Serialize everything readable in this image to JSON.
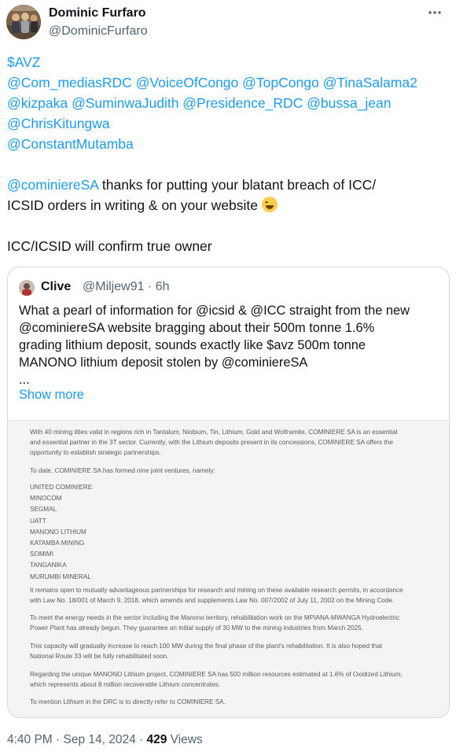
{
  "author": {
    "name": "Dominic Furfaro",
    "handle": "@DominicFurfaro"
  },
  "more_icon": "ellipsis-icon",
  "tweet": {
    "line1": "$AVZ",
    "line2": [
      "@Com_mediasRDC",
      "@VoiceOfCongo",
      "@TopCongo",
      "@TinaSalama2"
    ],
    "line3": [
      "@kizpaka",
      "@SuminwaJudith",
      "@Presidence_RDC",
      "@bussa_jean"
    ],
    "line4": "@ChrisKitungwa",
    "line5": "@ConstantMutamba",
    "para_mention": "@cominiereSA",
    "para_text_1": " thanks for putting your blatant breach of ICC/",
    "para_text_2": "ICSID orders in writing & on your website ",
    "emoji": "face-with-tears-of-joy-emoji",
    "closing": "ICC/ICSID will confirm true owner"
  },
  "quote": {
    "name": "Clive",
    "meta": "@Miljew91 · 6h",
    "lines": [
      "What a pearl of information for @icsid & @ICC straight from the new",
      "@cominiereSA website bragging about their 500m tonne 1.6%",
      "grading lithium deposit, sounds exactly like $avz 500m tonne",
      "MANONO lithium deposit stolen by @cominiereSA",
      "..."
    ],
    "show_more": "Show more",
    "document": {
      "intro_1": "With 40 mining titles valid in regions rich in Tantalum, Niobium, Tin, Lithium, Gold and Wolframite, COMINIERE SA is an essential",
      "intro_2": "and essential partner in the 3T sector. Currently, with the Lithium deposits present in its concessions, COMINIERE SA offers the",
      "intro_3": "opportunity to establish strategic partnerships.",
      "jv_intro": "To date, COMINIERE SA has formed nine joint ventures, namely:",
      "joint_ventures": [
        "UNITED COMINIERE",
        "MINOCOM",
        "SEGMAL",
        "UATT",
        "MANONO LITHIUM",
        "KATAMBA MINING",
        "SOMIMI",
        "TANGANIKA",
        "MURUMBI MINERAL"
      ],
      "p1_1": "It remains open to mutually advantageous partnerships for research and mining on these available research permits, in accordance",
      "p1_2": "with Law No. 18/001 of March 9, 2018, which amends and supplements Law No. 007/2002 of July 11, 2002 on the Mining Code.",
      "p2_1": "To meet the energy needs in the sector including the Manono territory, rehabilitation work on the MPIANA-MWANGA Hydroelectric",
      "p2_2": "Power Plant has already begun. They guarantee an initial supply of 30 MW to the mining industries from March 2025.",
      "p3_1": "This capacity will gradually increase to reach 100 MW during the final phase of the plant's rehabilitation. It is also hoped that",
      "p3_2": "National Route 33 will be fully rehabilitated soon.",
      "p4_1": "Regarding the unique MANONO Lithium project, COMINIERE SA has 500 million resources estimated at 1.6% of Oxidized Lithium,",
      "p4_2": "which represents about 8 million recoverable Lithium concentrates.",
      "p5": "To mention Lithium in the DRC is to directly refer to COMINIERE SA."
    }
  },
  "footer": {
    "timestamp": "4:40 PM · Sep 14, 2024 · ",
    "views_count": "429",
    "views_label": " Views"
  }
}
